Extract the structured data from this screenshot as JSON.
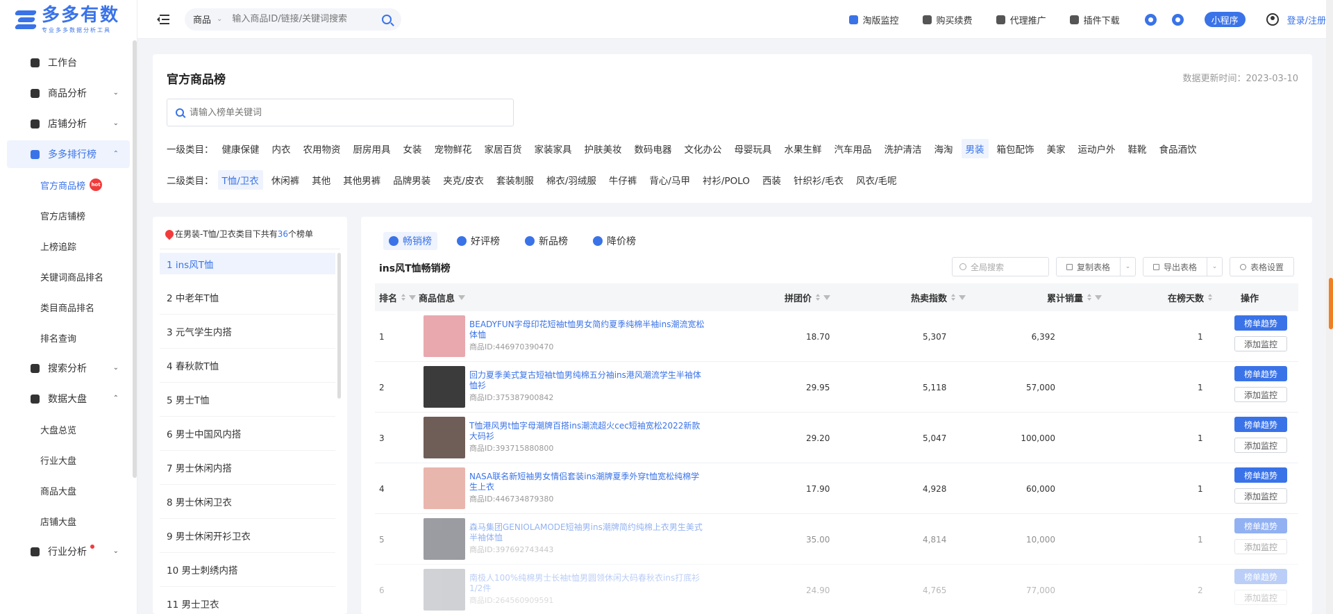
{
  "brand": {
    "title": "多多有数",
    "subtitle": "专业多多数据分析工具"
  },
  "sidebar": {
    "items": [
      {
        "label": "工作台",
        "type": "nav"
      },
      {
        "label": "商品分析",
        "type": "nav",
        "chevron": "⌄"
      },
      {
        "label": "店铺分析",
        "type": "nav",
        "chevron": "⌄"
      },
      {
        "label": "多多排行榜",
        "type": "nav",
        "chevron": "⌃",
        "active": true
      },
      {
        "label": "官方商品榜",
        "type": "sub",
        "active": true,
        "badge": "hot"
      },
      {
        "label": "官方店铺榜",
        "type": "sub"
      },
      {
        "label": "上榜追踪",
        "type": "sub"
      },
      {
        "label": "关键词商品排名",
        "type": "sub"
      },
      {
        "label": "类目商品排名",
        "type": "sub"
      },
      {
        "label": "排名查询",
        "type": "sub"
      },
      {
        "label": "搜索分析",
        "type": "nav",
        "chevron": "⌄"
      },
      {
        "label": "数据大盘",
        "type": "nav",
        "chevron": "⌃"
      },
      {
        "label": "大盘总览",
        "type": "sub"
      },
      {
        "label": "行业大盘",
        "type": "sub"
      },
      {
        "label": "商品大盘",
        "type": "sub"
      },
      {
        "label": "店铺大盘",
        "type": "sub"
      },
      {
        "label": "行业分析",
        "type": "nav",
        "chevron": "⌄",
        "dot": true
      }
    ]
  },
  "header": {
    "search_type": "商品",
    "search_placeholder": "输入商品ID/链接/关键词搜索",
    "links": [
      "淘版监控",
      "购买续费",
      "代理推广",
      "插件下载"
    ],
    "mini_program": "小程序",
    "login": "登录/注册"
  },
  "category": {
    "title": "官方商品榜",
    "update_time": "数据更新时间：2023-03-10",
    "search_placeholder": "请输入榜单关键词",
    "level1_label": "一级类目：",
    "level1": [
      "健康保健",
      "内衣",
      "农用物资",
      "厨房用具",
      "女装",
      "宠物鲜花",
      "家居百货",
      "家装家具",
      "护肤美妆",
      "数码电器",
      "文化办公",
      "母婴玩具",
      "水果生鲜",
      "汽车用品",
      "洗护清洁",
      "海淘",
      "男装",
      "箱包配饰",
      "美家",
      "运动户外",
      "鞋靴",
      "食品酒饮"
    ],
    "level1_selected": "男装",
    "level2_label": "二级类目：",
    "level2": [
      "T恤/卫衣",
      "休闲裤",
      "其他",
      "其他男裤",
      "品牌男装",
      "夹克/皮衣",
      "套装制服",
      "棉衣/羽绒服",
      "牛仔裤",
      "背心/马甲",
      "衬衫/POLO",
      "西装",
      "针织衫/毛衣",
      "风衣/毛呢"
    ],
    "level2_selected": "T恤/卫衣"
  },
  "list": {
    "head_prefix": "在男装-T恤/卫衣类目下共有",
    "head_count": "36",
    "head_suffix": "个榜单",
    "items": [
      "1 ins风T恤",
      "2 中老年T恤",
      "3 元气学生内搭",
      "4 春秋款T恤",
      "5 男士T恤",
      "6 男士中国风内搭",
      "7 男士休闲内搭",
      "8 男士休闲卫衣",
      "9 男士休闲开衫卫衣",
      "10 男士刺绣内搭",
      "11 男士卫衣"
    ]
  },
  "table": {
    "tabs": [
      "畅销榜",
      "好评榜",
      "新品榜",
      "降价榜"
    ],
    "tab_icons": [
      "trend-icon",
      "star-icon",
      "new-icon",
      "down-arrow-icon"
    ],
    "title": "ins风T恤畅销榜",
    "search_placeholder": "全局搜索",
    "copy_label": "复制表格",
    "export_label": "导出表格",
    "settings_label": "表格设置",
    "columns": [
      "排名",
      "商品信息",
      "拼团价",
      "热卖指数",
      "累计销量",
      "在榜天数",
      "操作"
    ],
    "trend_btn": "榜单趋势",
    "monitor_btn": "添加监控",
    "rows": [
      {
        "rank": "1",
        "name": "BEADYFUN字母印花短袖t恤男女简约夏季纯棉半袖ins潮流宽松体恤",
        "id": "商品ID:446970390470",
        "price": "18.70",
        "hot": "5,307",
        "sales": "6,392",
        "days": "1",
        "thumb": "#e8a8ad"
      },
      {
        "rank": "2",
        "name": "回力夏季美式复古短袖t恤男纯棉五分袖ins港风潮流学生半袖体恤衫",
        "id": "商品ID:375387900842",
        "price": "29.95",
        "hot": "5,118",
        "sales": "57,000",
        "days": "1",
        "thumb": "#3b3b3b"
      },
      {
        "rank": "3",
        "name": "T恤港风男t恤字母潮牌百搭ins潮流超火cec短袖宽松2022新款大码衫",
        "id": "商品ID:393715880800",
        "price": "29.20",
        "hot": "5,047",
        "sales": "100,000",
        "days": "1",
        "thumb": "#6f5d58"
      },
      {
        "rank": "4",
        "name": "NASA联名新短袖男女情侣套装ins潮牌夏季外穿t恤宽松纯棉学生上衣",
        "id": "商品ID:446734879380",
        "price": "17.90",
        "hot": "4,928",
        "sales": "60,000",
        "days": "1",
        "thumb": "#e9b6ad"
      },
      {
        "rank": "5",
        "name": "森马集团GENIOLAMODE短袖男ins潮牌简约纯棉上衣男生美式半袖体恤",
        "id": "商品ID:397692743443",
        "price": "35.00",
        "hot": "4,814",
        "sales": "10,000",
        "days": "1",
        "thumb": "#4a4d55"
      },
      {
        "rank": "6",
        "name": "南极人100%纯棉男士长袖t恤男圆领休闲大码春秋衣ins打底衫1/2件",
        "id": "商品ID:264560909591",
        "price": "24.90",
        "hot": "4,765",
        "sales": "77,000",
        "days": "2",
        "thumb": "#7a7e86"
      }
    ]
  }
}
